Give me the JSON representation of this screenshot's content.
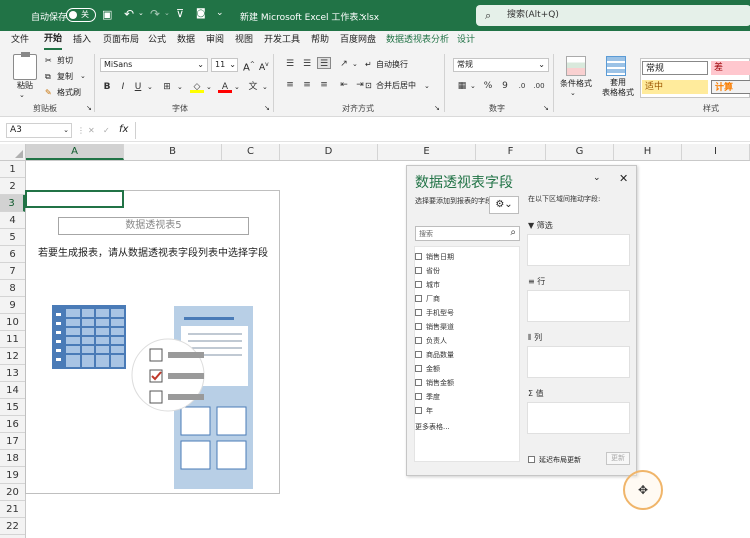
{
  "titlebar": {
    "autosave_label": "自动保存",
    "toggle_state": "关",
    "doc_title": "新建 Microsoft Excel 工作表.xlsx",
    "search_placeholder": "搜索(Alt+Q)"
  },
  "menu": [
    "文件",
    "开始",
    "插入",
    "页面布局",
    "公式",
    "数据",
    "审阅",
    "视图",
    "开发工具",
    "帮助",
    "百度网盘",
    "数据透视表分析",
    "设计"
  ],
  "ribbon": {
    "paste": "粘贴",
    "cut": "剪切",
    "copy": "复制",
    "format_painter": "格式刷",
    "clipboard": "剪贴板",
    "font_name": "MiSans",
    "font_size": "11",
    "font_group": "字体",
    "bold": "B",
    "italic": "I",
    "underline": "U",
    "wrap_text": "自动换行",
    "merge_center": "合并后居中",
    "align_group": "对齐方式",
    "number_format": "常规",
    "number_group": "数字",
    "cond_format": "条件格式",
    "table_format": "套用\n表格格式",
    "style_normal": "常规",
    "style_bad": "差",
    "style_neutral": "适中",
    "style_calc": "计算",
    "styles_group": "样式",
    "colors": {
      "bad_bg": "#ffc7ce",
      "bad_fg": "#9c0006",
      "neutral_bg": "#ffeb9c",
      "neutral_fg": "#9c5700",
      "calc_bg": "#f2f2f2",
      "calc_fg": "#fa7d00"
    }
  },
  "formula_bar": {
    "name_box": "A3",
    "cancel": "✕",
    "enter": "✓",
    "fx": "fx",
    "value": ""
  },
  "grid": {
    "columns": [
      "A",
      "B",
      "C",
      "D",
      "E",
      "F",
      "G",
      "H",
      "I"
    ],
    "rows": [
      "1",
      "2",
      "3",
      "4",
      "5",
      "6",
      "7",
      "8",
      "9",
      "10",
      "11",
      "12",
      "13",
      "14",
      "15",
      "16",
      "17",
      "18",
      "19",
      "20",
      "21",
      "22"
    ],
    "selected_cell": "A3"
  },
  "pivot": {
    "name": "数据透视表5",
    "message": "若要生成报表，请从数据透视表字段列表中选择字段"
  },
  "pane": {
    "title": "数据透视表字段",
    "choose_fields": "选择要添加到报表的字段:",
    "search_placeholder": "搜索",
    "fields": [
      "销售日期",
      "省份",
      "城市",
      "厂商",
      "手机型号",
      "销售渠道",
      "负责人",
      "商品数量",
      "金额",
      "销售金额",
      "季度",
      "年"
    ],
    "more_tables": "更多表格...",
    "drag_hint": "在以下区域间拖动字段:",
    "areas": {
      "filters": "筛选",
      "rows": "行",
      "columns": "列",
      "values": "值"
    },
    "defer_label": "延迟布局更新",
    "update_button": "更新"
  },
  "colors": {
    "accent": "#217346"
  }
}
